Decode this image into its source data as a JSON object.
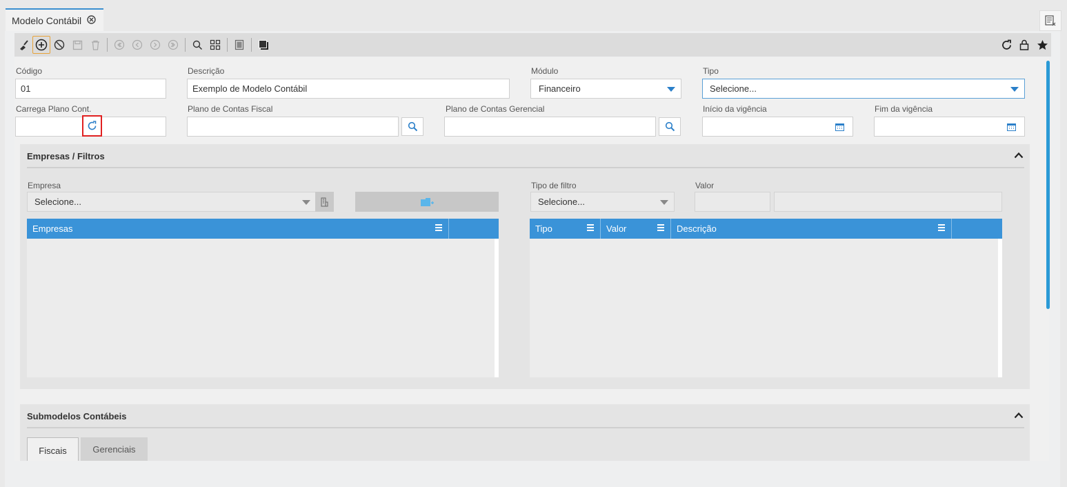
{
  "tab": {
    "title": "Modelo Contábil"
  },
  "form": {
    "codigo": {
      "label": "Código",
      "value": "01"
    },
    "descricao": {
      "label": "Descrição",
      "value": "Exemplo de Modelo Contábil"
    },
    "modulo": {
      "label": "Módulo",
      "value": "Financeiro"
    },
    "tipo": {
      "label": "Tipo",
      "value": "Selecione..."
    },
    "carrega": {
      "label": "Carrega Plano Cont."
    },
    "plano_fiscal": {
      "label": "Plano de Contas Fiscal",
      "value": ""
    },
    "plano_gerencial": {
      "label": "Plano de Contas Gerencial",
      "value": ""
    },
    "inicio": {
      "label": "Início da vigência",
      "value": ""
    },
    "fim": {
      "label": "Fim da vigência",
      "value": ""
    }
  },
  "empresas_panel": {
    "title": "Empresas / Filtros",
    "empresa_label": "Empresa",
    "empresa_select": "Selecione...",
    "tipo_filtro_label": "Tipo de filtro",
    "tipo_filtro_select": "Selecione...",
    "valor_label": "Valor",
    "grid_left_headers": [
      "Empresas"
    ],
    "grid_right_headers": [
      "Tipo",
      "Valor",
      "Descrição"
    ]
  },
  "submodelos_panel": {
    "title": "Submodelos Contábeis",
    "tabs": [
      "Fiscais",
      "Gerenciais"
    ]
  },
  "colors": {
    "accent": "#3a93d8",
    "highlight": "#e02020"
  }
}
